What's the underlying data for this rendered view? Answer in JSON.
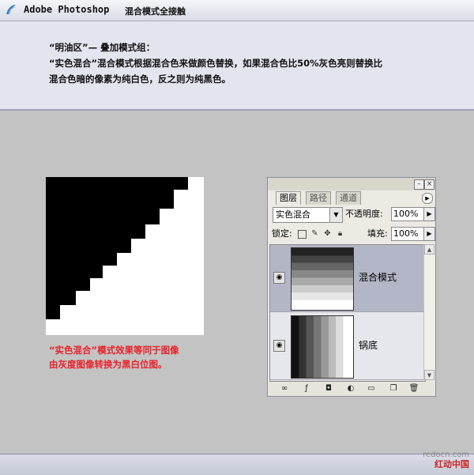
{
  "header": {
    "app_title": "Adobe Photoshop",
    "subtitle": "混合模式全接触",
    "desc_line1": "“明油区”— 叠加模式组：",
    "desc_line2": "“实色混合”混合模式根据混合色来做颜色替换，如果混合色比50%灰色亮则替换比",
    "desc_line3": "混合色暗的像素为纯白色，反之则为纯黑色。"
  },
  "demo": {
    "caption_line1": "“实色混合”模式效果等同于图像",
    "caption_line2": "由灰度图像转换为黑白位图。"
  },
  "layers_panel": {
    "tabs": [
      "图层",
      "路径",
      "通道"
    ],
    "blend_mode": "实色混合",
    "opacity_label": "不透明度:",
    "opacity_value": "100%",
    "lock_label": "锁定:",
    "fill_label": "填充:",
    "fill_value": "100%",
    "layers": [
      {
        "name": "混合模式",
        "selected": true
      },
      {
        "name": "锅底",
        "selected": false
      }
    ]
  },
  "watermark": {
    "line1": "redocn.com",
    "line2": "红动中国"
  },
  "colors": {
    "accent_red": "#e8232b",
    "header_bg": "#e3e5ee",
    "page_bg": "#c3c3c3"
  }
}
